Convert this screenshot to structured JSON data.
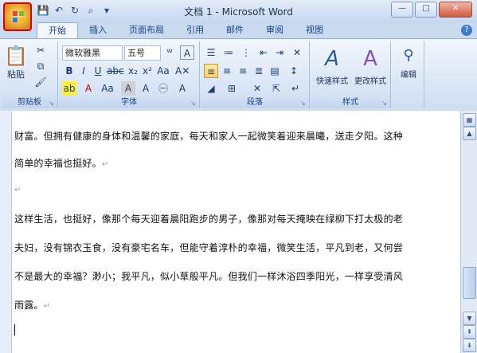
{
  "window": {
    "title": "文档 1 - Microsoft Word",
    "minimize": "—",
    "restore": "□",
    "close": "✕"
  },
  "quick_access": {
    "save_icon": "save-icon",
    "undo_icon": "undo-icon",
    "redo_icon": "redo-icon",
    "preview_icon": "print-preview-icon"
  },
  "tabs": [
    "开始",
    "插入",
    "页面布局",
    "引用",
    "邮件",
    "审阅",
    "视图"
  ],
  "ribbon": {
    "clipboard": {
      "label": "剪贴板",
      "paste": "粘贴"
    },
    "font": {
      "label": "字体",
      "family": "微软雅黑",
      "size": "五号"
    },
    "paragraph": {
      "label": "段落"
    },
    "styles": {
      "label": "样式",
      "quick": "快速样式",
      "change": "更改样式"
    },
    "editing": {
      "label": "编辑"
    }
  },
  "document": {
    "lines": [
      "财富。但拥有健康的身体和温馨的家庭，每天和家人一起微笑着迎来晨曦，送走夕阳。这种",
      "简单的幸福也挺好。",
      "",
      "这样生活，也挺好，像那个每天迎着晨阳跑步的男子，像那对每天掩映在绿柳下打太极的老",
      "夫妇，没有锦衣玉食，没有豪宅名车，但能守着淳朴的幸福，微笑生活，平凡到老，又何尝",
      "不是最大的幸福？渺小；我平凡，似小草般平凡。但我们一样沐浴四季阳光，一样享受清风",
      "雨露。"
    ],
    "pilcrow": "↵"
  },
  "colors": {
    "accent": "#15428b",
    "ribbon": "#dbe7f6",
    "highlight": "#ffcf5e"
  }
}
